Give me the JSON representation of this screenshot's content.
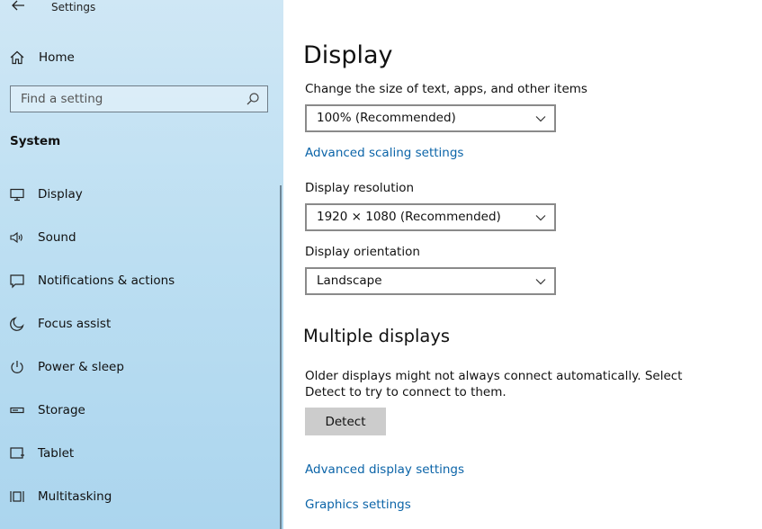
{
  "window": {
    "title": "Settings"
  },
  "sidebar": {
    "home_label": "Home",
    "search_placeholder": "Find a setting",
    "section_title": "System",
    "items": [
      {
        "label": "Display",
        "icon": "monitor-icon"
      },
      {
        "label": "Sound",
        "icon": "speaker-icon"
      },
      {
        "label": "Notifications & actions",
        "icon": "notification-icon"
      },
      {
        "label": "Focus assist",
        "icon": "moon-icon"
      },
      {
        "label": "Power & sleep",
        "icon": "power-icon"
      },
      {
        "label": "Storage",
        "icon": "storage-icon"
      },
      {
        "label": "Tablet",
        "icon": "tablet-icon"
      },
      {
        "label": "Multitasking",
        "icon": "multitasking-icon"
      }
    ]
  },
  "main": {
    "title": "Display",
    "scale_label": "Change the size of text, apps, and other items",
    "scale_value": "100% (Recommended)",
    "advanced_scaling_link": "Advanced scaling settings",
    "resolution_label": "Display resolution",
    "resolution_value": "1920 × 1080 (Recommended)",
    "orientation_label": "Display orientation",
    "orientation_value": "Landscape",
    "multiple_title": "Multiple displays",
    "multiple_desc": "Older displays might not always connect automatically. Select Detect to try to connect to them.",
    "detect_button": "Detect",
    "advanced_display_link": "Advanced display settings",
    "graphics_link": "Graphics settings"
  },
  "colors": {
    "accent": "#0b64a8",
    "sidebar": "#bddff2"
  }
}
